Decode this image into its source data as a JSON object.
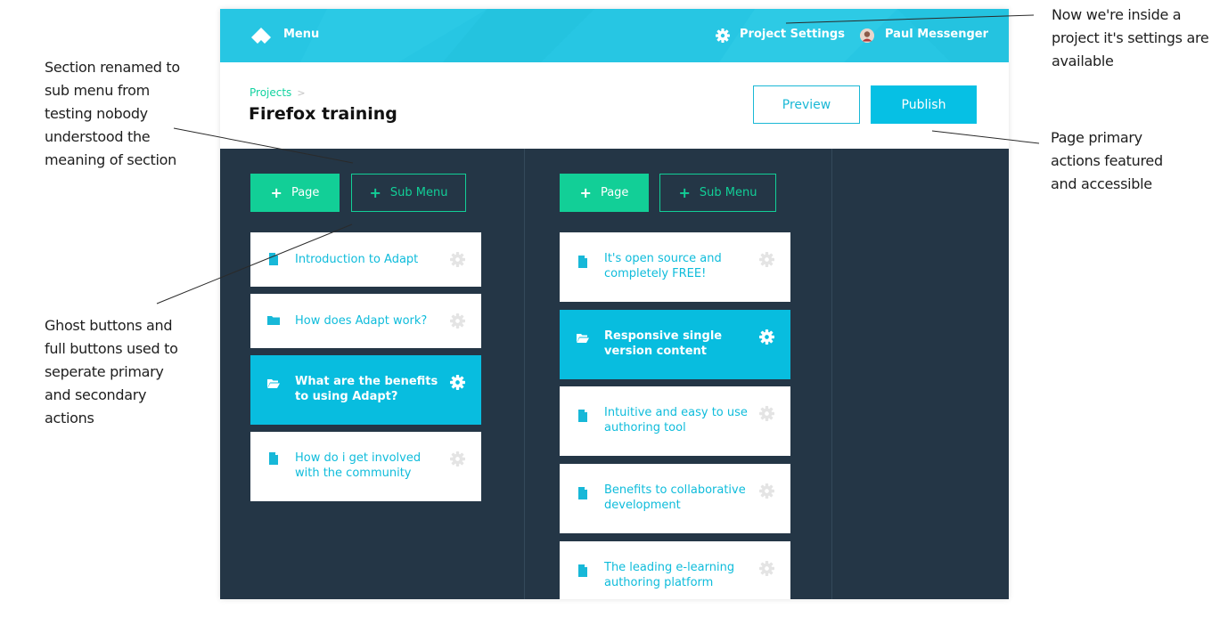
{
  "annotations": {
    "section_rename": [
      "Section renamed to",
      "sub menu from",
      "testing nobody",
      "understood the",
      "meaning of section"
    ],
    "ghost_buttons": [
      "Ghost buttons and",
      "full buttons used to",
      "seperate primary",
      "and secondary",
      "actions"
    ],
    "project_settings": [
      "Now we're  inside a",
      "project it's settings are",
      "available"
    ],
    "primary_actions": [
      "Page primary",
      "actions featured",
      "and accessible"
    ]
  },
  "topbar": {
    "menu_label": "Menu",
    "settings_label": "Project Settings",
    "user_name": "Paul Messenger"
  },
  "header": {
    "breadcrumb": "Projects",
    "breadcrumb_sep": ">",
    "title": "Firefox training",
    "preview_label": "Preview",
    "publish_label": "Publish"
  },
  "columns": [
    {
      "add_page_label": "Page",
      "add_submenu_label": "Sub Menu",
      "items": [
        {
          "label": "Introduction to Adapt",
          "icon": "file-icon",
          "active": false
        },
        {
          "label": "How does Adapt work?",
          "icon": "folder-icon",
          "active": false
        },
        {
          "label": "What are the benefits to using Adapt?",
          "icon": "folder-open-icon",
          "active": true
        },
        {
          "label": "How do i get involved with the community",
          "icon": "file-icon",
          "active": false
        }
      ]
    },
    {
      "add_page_label": "Page",
      "add_submenu_label": "Sub Menu",
      "items": [
        {
          "label": "It's open source and completely FREE!",
          "icon": "file-icon",
          "active": false
        },
        {
          "label": "Responsive single version content",
          "icon": "folder-open-icon",
          "active": true
        },
        {
          "label": "Intuitive and easy to use authoring tool",
          "icon": "file-icon",
          "active": false
        },
        {
          "label": "Benefits to collaborative development",
          "icon": "file-icon",
          "active": false
        },
        {
          "label": "The leading e-learning authoring platform",
          "icon": "file-icon",
          "active": false
        }
      ]
    }
  ],
  "colors": {
    "topbar": "#27c6e3",
    "accent_blue": "#06c0e4",
    "accent_green": "#12cf97",
    "workspace": "#243646"
  }
}
